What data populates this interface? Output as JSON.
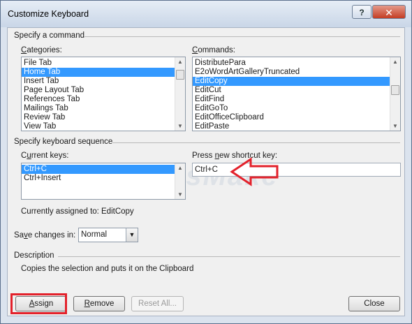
{
  "window": {
    "title": "Customize Keyboard",
    "help_glyph": "?",
    "close_glyph": "✕"
  },
  "specify_command": {
    "legend": "Specify a command",
    "categories_label": "Categories:",
    "categories": [
      "File Tab",
      "Home Tab",
      "Insert Tab",
      "Page Layout Tab",
      "References Tab",
      "Mailings Tab",
      "Review Tab",
      "View Tab"
    ],
    "commands_label": "Commands:",
    "commands": [
      "DistributePara",
      "E2oWordArtGalleryTruncated",
      "EditCopy",
      "EditCut",
      "EditFind",
      "EditGoTo",
      "EditOfficeClipboard",
      "EditPaste"
    ]
  },
  "keyboard_sequence": {
    "legend": "Specify keyboard sequence",
    "current_keys_label": "Current keys:",
    "current_keys": [
      "Ctrl+C",
      "Ctrl+Insert"
    ],
    "new_key_label": "Press new shortcut key:",
    "new_key_value": "Ctrl+C",
    "assigned_label": "Currently assigned to:",
    "assigned_value": "EditCopy",
    "save_label": "Save changes in:",
    "save_value": "Normal"
  },
  "description": {
    "legend": "Description",
    "text": "Copies the selection and puts it on the Clipboard"
  },
  "buttons": {
    "assign": "Assign",
    "remove": "Remove",
    "reset_all": "Reset All...",
    "close": "Close"
  },
  "watermark": "TipsMake",
  "colors": {
    "selection": "#3399ff",
    "annotation_red": "#e3212b"
  }
}
